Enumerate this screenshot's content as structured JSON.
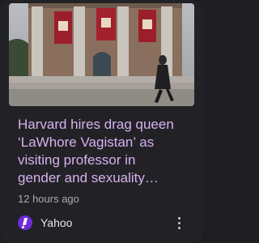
{
  "article": {
    "image": {
      "subject": "harvard-building-with-crimson-banners"
    },
    "headline_lines": [
      "Harvard hires drag queen",
      "‘LaWhore Vagistan’ as",
      "visiting professor in",
      "gender and sexuality…"
    ],
    "timestamp": "12 hours ago",
    "source": {
      "name": "Yahoo",
      "logo_icon": "yahoo-logo-icon",
      "logo_color": "#6f2bd9"
    },
    "menu_icon": "more-vertical-icon",
    "headline_color": "#d7b1f0"
  }
}
